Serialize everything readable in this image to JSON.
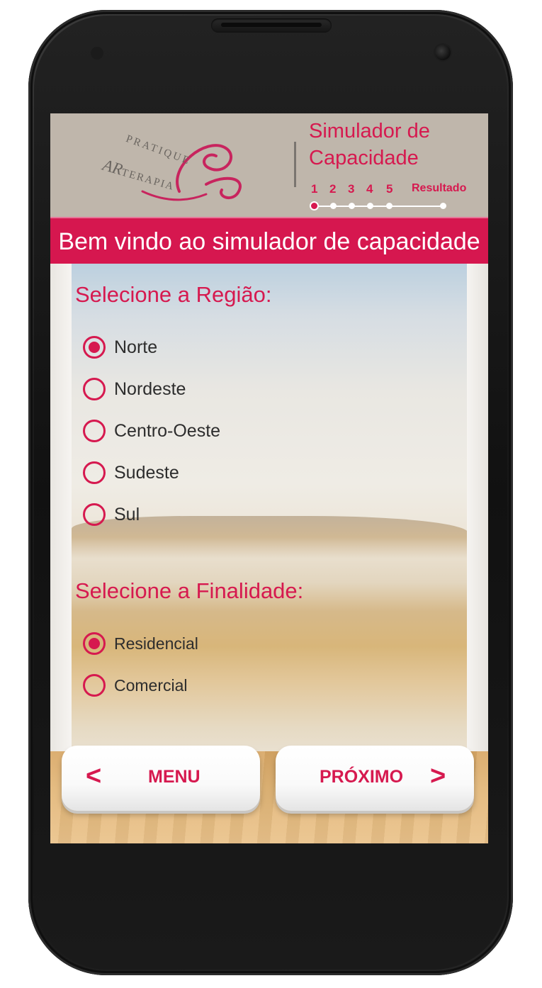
{
  "header": {
    "logo": {
      "line1": "PRATIQUE",
      "line2_big": "AR",
      "line2_small": "TERAPIA"
    },
    "title": "Simulador de Capacidade",
    "steps": [
      "1",
      "2",
      "3",
      "4",
      "5",
      "Resultado"
    ],
    "current_step": 1
  },
  "banner": {
    "text": "Bem vindo ao simulador de capacidade"
  },
  "region": {
    "title": "Selecione a Região:",
    "options": [
      "Norte",
      "Nordeste",
      "Centro-Oeste",
      "Sudeste",
      "Sul"
    ],
    "selected": "Norte"
  },
  "purpose": {
    "title": "Selecione a Finalidade:",
    "options": [
      "Residencial",
      "Comercial"
    ],
    "selected": "Residencial"
  },
  "buttons": {
    "menu": {
      "label": "MENU",
      "arrow": "<"
    },
    "next": {
      "label": "PRÓXIMO",
      "arrow": ">"
    }
  },
  "colors": {
    "accent": "#d6194f",
    "header_bg": "#bfb6ab"
  }
}
